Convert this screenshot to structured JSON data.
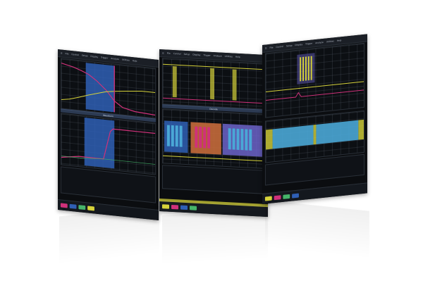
{
  "app": {
    "title": "",
    "panels": [
      {
        "id": "p1",
        "name": "panel-left",
        "menu": [
          "File",
          "Control",
          "Setup",
          "Display",
          "Trigger",
          "Analyze",
          "Utilities",
          "Help"
        ],
        "section_labels": [
          "Overview",
          "Waveform",
          "Measurements"
        ],
        "table": {
          "rows": [
            [
              "",
              "",
              "",
              ""
            ],
            [
              "",
              "",
              "",
              ""
            ],
            [
              "",
              "",
              "",
              ""
            ],
            [
              "",
              "",
              "",
              ""
            ]
          ]
        }
      },
      {
        "id": "p2",
        "name": "panel-middle",
        "menu": [
          "File",
          "Control",
          "Setup",
          "Display",
          "Trigger",
          "Analyze",
          "Utilities",
          "Help"
        ],
        "section_labels": [
          "Protocol",
          "Decode",
          "Packets"
        ],
        "table": {
          "rows": [
            [
              "",
              "",
              "",
              ""
            ],
            [
              "",
              "",
              "",
              ""
            ],
            [
              "",
              "",
              "",
              ""
            ]
          ]
        }
      },
      {
        "id": "p3",
        "name": "panel-right",
        "menu": [
          "File",
          "Control",
          "Setup",
          "Display",
          "Trigger",
          "Analyze",
          "Utilities",
          "Help"
        ],
        "section_labels": [
          "Zoom",
          "Decode"
        ],
        "table": {
          "rows": [
            [
              "",
              "",
              "",
              ""
            ],
            [
              "",
              "",
              "",
              ""
            ]
          ]
        }
      }
    ],
    "colors": {
      "bg": "#ffffff",
      "screen": "#0b0d10",
      "grid": "#2a3038",
      "yellow": "#d6d23a",
      "magenta": "#d0317a",
      "cyan": "#4aa7d6",
      "blue": "#2f5fb5",
      "orange": "#c46a3b",
      "green": "#46b46a",
      "purple": "#6c63c9"
    },
    "icons": {
      "chip": "status-chip",
      "menu": "menu-icon"
    }
  }
}
